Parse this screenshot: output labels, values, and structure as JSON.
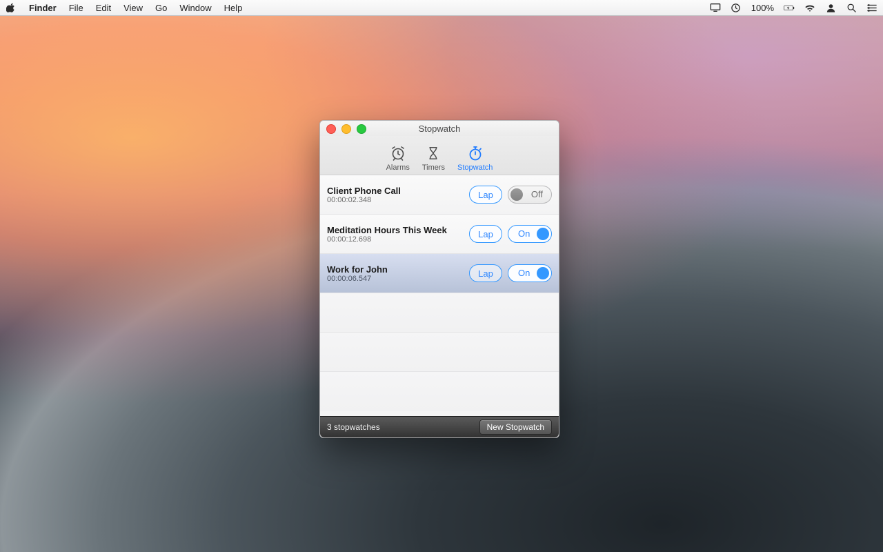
{
  "menubar": {
    "app": "Finder",
    "items": [
      "File",
      "Edit",
      "View",
      "Go",
      "Window",
      "Help"
    ],
    "battery": "100%"
  },
  "window": {
    "title": "Stopwatch",
    "tabs": [
      {
        "label": "Alarms",
        "active": false
      },
      {
        "label": "Timers",
        "active": false
      },
      {
        "label": "Stopwatch",
        "active": true
      }
    ],
    "lap_label": "Lap",
    "toggle_on_label": "On",
    "toggle_off_label": "Off",
    "stopwatches": [
      {
        "name": "Client Phone Call",
        "time": "00:00:02.348",
        "running": false,
        "selected": false
      },
      {
        "name": "Meditation Hours This Week",
        "time": "00:00:12.698",
        "running": true,
        "selected": false
      },
      {
        "name": "Work for John",
        "time": "00:00:06.547",
        "running": true,
        "selected": true
      }
    ],
    "footer": {
      "count": "3 stopwatches",
      "new_label": "New Stopwatch"
    }
  }
}
